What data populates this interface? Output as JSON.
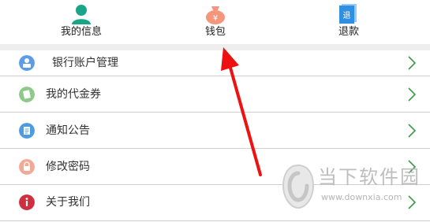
{
  "top_tabs": [
    {
      "label": "我的信息",
      "icon": "person-icon",
      "color": "#1aa589"
    },
    {
      "label": "钱包",
      "icon": "money-bag-icon",
      "icon_text": "¥",
      "color": "#f3967b"
    },
    {
      "label": "退款",
      "icon": "refund-icon",
      "icon_text": "退",
      "color": "#2f8fe3"
    }
  ],
  "menu": [
    {
      "label": "银行账户管理",
      "icon": "bank-account-icon",
      "color": "#5b9be8"
    },
    {
      "label": "我的代金券",
      "icon": "voucher-icon",
      "color": "#8ec98a"
    },
    {
      "label": "通知公告",
      "icon": "notice-icon",
      "color": "#4d9be0"
    },
    {
      "label": "修改密码",
      "icon": "lock-icon",
      "color": "#f0aa96"
    },
    {
      "label": "关于我们",
      "icon": "info-icon",
      "color": "#cf3040"
    }
  ],
  "watermark": {
    "brand": "当下软件园",
    "url": "www.downxia.com"
  },
  "colors": {
    "chevron": "#3a9a4a",
    "arrow": "#ee1111",
    "divider": "#cfcfcf",
    "separator": "#eeeeee"
  }
}
